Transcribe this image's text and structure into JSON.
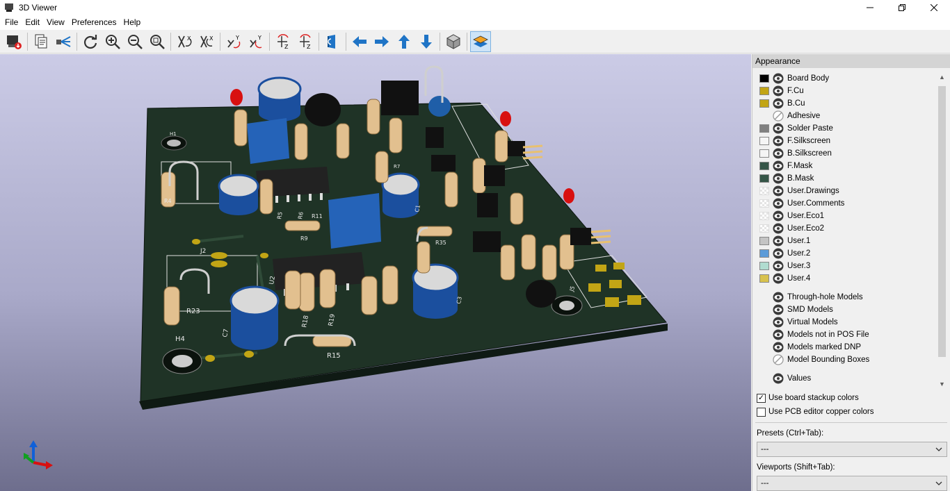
{
  "window": {
    "title": "3D Viewer"
  },
  "menu": [
    "File",
    "Edit",
    "View",
    "Preferences",
    "Help"
  ],
  "toolbar": {
    "icons": [
      "render-raytrace-icon",
      "copy-image-icon",
      "lighting-icon",
      "reload-icon",
      "zoom-in-icon",
      "zoom-out-icon",
      "zoom-fit-icon",
      "rotate-x-cw-icon",
      "rotate-x-ccw-icon",
      "rotate-y-cw-icon",
      "rotate-y-ccw-icon",
      "rotate-z-cw-icon",
      "rotate-z-ccw-icon",
      "flip-board-icon",
      "move-left-icon",
      "move-right-icon",
      "move-up-icon",
      "move-down-icon",
      "ortho-view-icon",
      "layers-manager-icon"
    ],
    "accent": "#1f74c6"
  },
  "board": {
    "labels": [
      "H1",
      "H4",
      "J2",
      "R4",
      "R5",
      "R6",
      "R7",
      "R9",
      "R11",
      "R15",
      "R18",
      "R19",
      "R23",
      "R35",
      "C1",
      "C3",
      "C7",
      "U2",
      "J5"
    ]
  },
  "appearance": {
    "title": "Appearance",
    "layers": [
      {
        "name": "Board Body",
        "color": "#000000",
        "swatch": "solid"
      },
      {
        "name": "F.Cu",
        "color": "#c2a515",
        "swatch": "solid"
      },
      {
        "name": "B.Cu",
        "color": "#c2a515",
        "swatch": "solid"
      },
      {
        "name": "Adhesive",
        "color": "",
        "swatch": "none"
      },
      {
        "name": "Solder Paste",
        "color": "#808080",
        "swatch": "solid"
      },
      {
        "name": "F.Silkscreen",
        "color": "#f5f5f5",
        "swatch": "solid"
      },
      {
        "name": "B.Silkscreen",
        "color": "#f5f5f5",
        "swatch": "solid"
      },
      {
        "name": "F.Mask",
        "color": "#355547",
        "swatch": "solid"
      },
      {
        "name": "B.Mask",
        "color": "#355547",
        "swatch": "solid"
      },
      {
        "name": "User.Drawings",
        "color": "",
        "swatch": "checker"
      },
      {
        "name": "User.Comments",
        "color": "",
        "swatch": "checker"
      },
      {
        "name": "User.Eco1",
        "color": "",
        "swatch": "checker"
      },
      {
        "name": "User.Eco2",
        "color": "",
        "swatch": "checker"
      },
      {
        "name": "User.1",
        "color": "#c4c4c4",
        "swatch": "solid"
      },
      {
        "name": "User.2",
        "color": "#5b9bd8",
        "swatch": "solid"
      },
      {
        "name": "User.3",
        "color": "#b0dcd0",
        "swatch": "solid"
      },
      {
        "name": "User.4",
        "color": "#d8c24e",
        "swatch": "solid"
      }
    ],
    "models": [
      {
        "name": "Through-hole Models",
        "icon": "eye-icon"
      },
      {
        "name": "SMD Models",
        "icon": "eye-icon"
      },
      {
        "name": "Virtual Models",
        "icon": "eye-icon"
      },
      {
        "name": "Models not in POS File",
        "icon": "eye-icon"
      },
      {
        "name": "Models marked DNP",
        "icon": "eye-icon"
      },
      {
        "name": "Model Bounding Boxes",
        "icon": "hidden-icon"
      }
    ],
    "values_row": {
      "name": "Values",
      "icon": "eye-icon"
    },
    "use_stackup": {
      "label": "Use board stackup colors",
      "checked": true
    },
    "use_pcb_copper": {
      "label": "Use PCB editor copper colors",
      "checked": false
    },
    "presets_label": "Presets (Ctrl+Tab):",
    "presets_value": "---",
    "viewports_label": "Viewports (Shift+Tab):",
    "viewports_value": "---"
  }
}
